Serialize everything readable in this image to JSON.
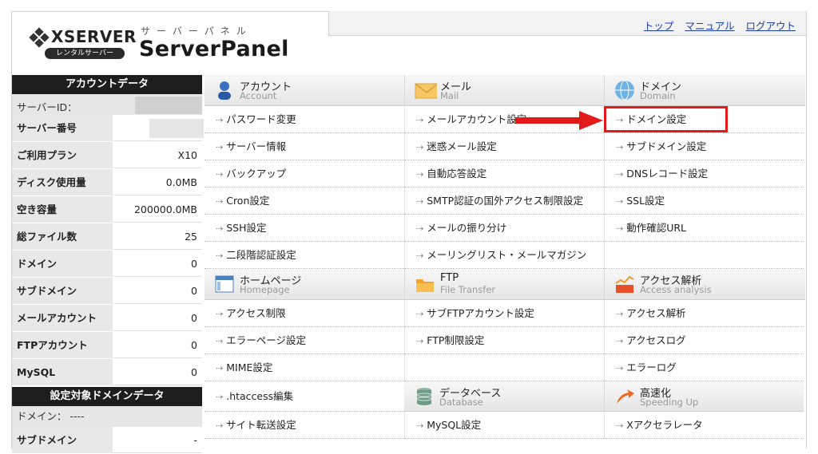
{
  "header": {
    "brand": "XSERVER",
    "badge": "レンタルサーバー",
    "subtitle": "サーバーパネル",
    "title": "ServerPanel",
    "links": [
      "トップ",
      "マニュアル",
      "ログアウト"
    ]
  },
  "account": {
    "heading": "アカウントデータ",
    "id_label": "サーバーID：",
    "rows": [
      {
        "label": "サーバー番号",
        "value": ""
      },
      {
        "label": "ご利用プラン",
        "value": "X10"
      },
      {
        "label": "ディスク使用量",
        "value": "0.0MB"
      },
      {
        "label": "空き容量",
        "value": "200000.0MB"
      },
      {
        "label": "総ファイル数",
        "value": "25"
      },
      {
        "label": "ドメイン",
        "value": "0"
      },
      {
        "label": "サブドメイン",
        "value": "0"
      },
      {
        "label": "メールアカウント",
        "value": "0"
      },
      {
        "label": "FTPアカウント",
        "value": "0"
      },
      {
        "label": "MySQL",
        "value": "0"
      }
    ]
  },
  "domain_data": {
    "heading": "設定対象ドメインデータ",
    "domain_label": "ドメイン： ----",
    "rows": [
      {
        "label": "サブドメイン",
        "value": "-"
      }
    ]
  },
  "sections": {
    "account": {
      "jp": "アカウント",
      "en": "Account",
      "icon": "account-icon"
    },
    "mail": {
      "jp": "メール",
      "en": "Mail",
      "icon": "mail-icon"
    },
    "domain": {
      "jp": "ドメイン",
      "en": "Domain",
      "icon": "globe-icon"
    },
    "homepage": {
      "jp": "ホームページ",
      "en": "Homepage",
      "icon": "homepage-icon"
    },
    "ftp": {
      "jp": "FTP",
      "en": "File Transfer",
      "icon": "folder-icon"
    },
    "analytics": {
      "jp": "アクセス解析",
      "en": "Access analysis",
      "icon": "chart-icon"
    },
    "database": {
      "jp": "データベース",
      "en": "Database",
      "icon": "database-icon"
    },
    "speed": {
      "jp": "高速化",
      "en": "Speeding Up",
      "icon": "speed-arrow-icon"
    }
  },
  "menu": {
    "account": [
      "パスワード変更",
      "サーバー情報",
      "バックアップ",
      "Cron設定",
      "SSH設定",
      "二段階認証設定"
    ],
    "mail": [
      "メールアカウント設定",
      "迷惑メール設定",
      "自動応答設定",
      "SMTP認証の国外アクセス制限設定",
      "メールの振り分け",
      "メーリングリスト・メールマガジン"
    ],
    "domain": [
      "ドメイン設定",
      "サブドメイン設定",
      "DNSレコード設定",
      "SSL設定",
      "動作確認URL"
    ],
    "homepage": [
      "アクセス制限",
      "エラーページ設定",
      "MIME設定",
      ".htaccess編集",
      "サイト転送設定"
    ],
    "ftp": [
      "サブFTPアカウント設定",
      "FTP制限設定"
    ],
    "analytics": [
      "アクセス解析",
      "アクセスログ",
      "エラーログ"
    ],
    "database": [
      "MySQL設定"
    ],
    "speed": [
      "Xアクセラレータ"
    ]
  },
  "colors": {
    "highlight": "#e21a1a",
    "link": "#1f3fa8",
    "dark_header": "#1e1e1e"
  }
}
